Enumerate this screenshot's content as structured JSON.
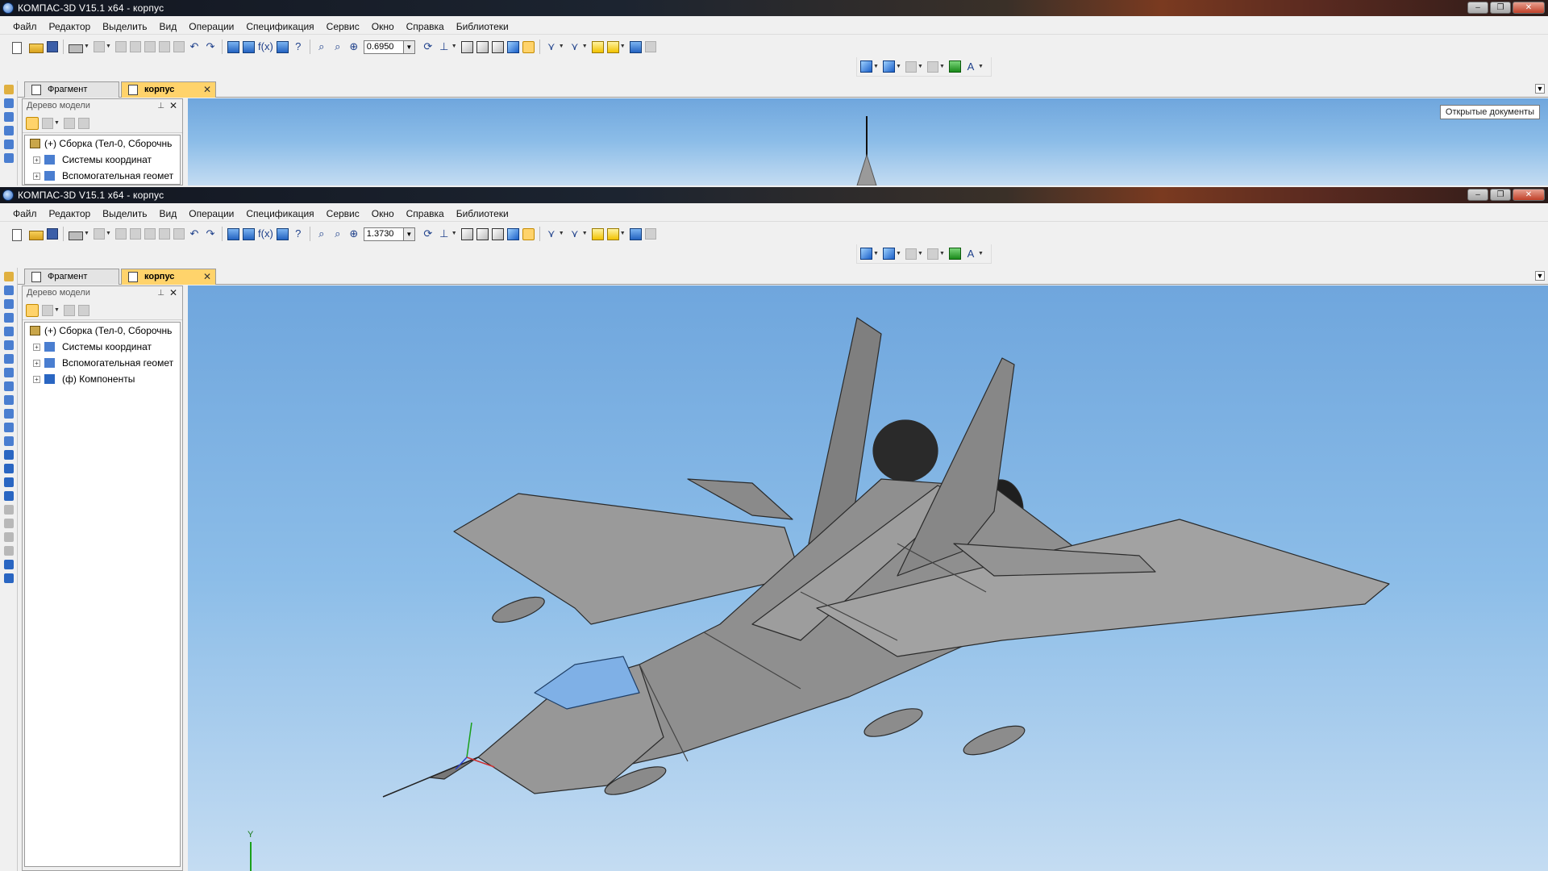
{
  "window": {
    "title": "КОМПАС-3D V15.1 x64 - корпус",
    "controls": {
      "minimize": "‒",
      "restore": "❐",
      "close": "✕"
    }
  },
  "menu": [
    "Файл",
    "Редактор",
    "Выделить",
    "Вид",
    "Операции",
    "Спецификация",
    "Сервис",
    "Окно",
    "Справка",
    "Библиотеки"
  ],
  "toolbar": {
    "zoom_top": "0.6950",
    "zoom_bottom": "1.3730",
    "function_label": "f(x)"
  },
  "tabs": {
    "fragment": "Фрагмент",
    "active": "корпус",
    "close": "✕"
  },
  "tooltip": "Открытые документы",
  "tree_panel": {
    "title": "Дерево модели",
    "pin": "⊥",
    "close": "✕",
    "items": [
      {
        "label": "(+) Сборка (Тел-0, Сборочнь",
        "expander": ""
      },
      {
        "label": "Системы координат",
        "expander": "+"
      },
      {
        "label": "Вспомогательная геомет",
        "expander": "+"
      },
      {
        "label": "(ф) Компоненты",
        "expander": "+"
      }
    ]
  },
  "axis_label": "Y",
  "colors": {
    "viewport_top": "#6fa6dd",
    "viewport_bottom": "#c4dcf2",
    "active_tab": "#ffd36b",
    "model_gray": "#8f8f8f"
  }
}
